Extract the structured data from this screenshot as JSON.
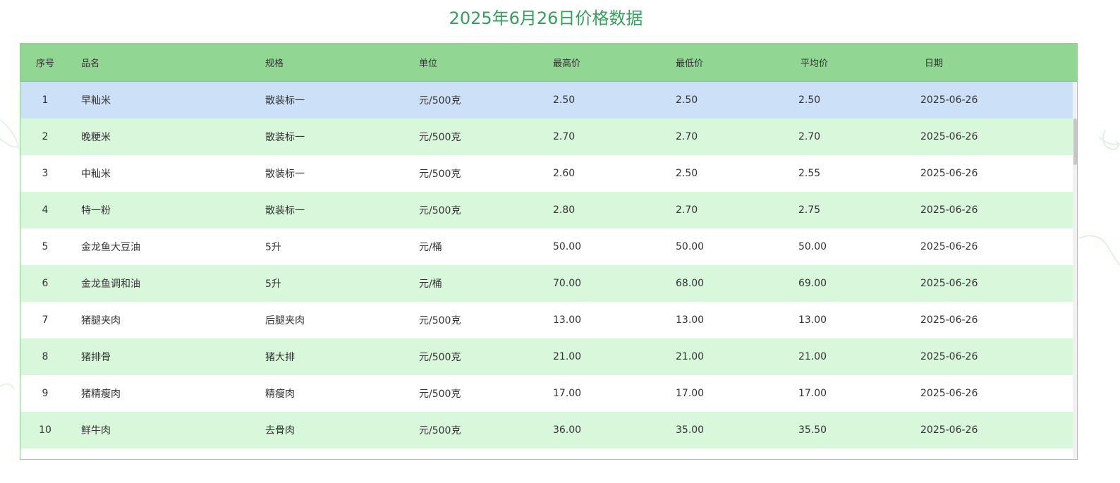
{
  "page": {
    "title": "2025年6月26日价格数据"
  },
  "table": {
    "headers": [
      "序号",
      "品名",
      "规格",
      "单位",
      "最高价",
      "最低价",
      "平均价",
      "日期"
    ],
    "rows": [
      [
        "1",
        "早籼米",
        "散装标一",
        "元/500克",
        "2.50",
        "2.50",
        "2.50",
        "2025-06-26"
      ],
      [
        "2",
        "晚粳米",
        "散装标一",
        "元/500克",
        "2.70",
        "2.70",
        "2.70",
        "2025-06-26"
      ],
      [
        "3",
        "中籼米",
        "散装标一",
        "元/500克",
        "2.60",
        "2.50",
        "2.55",
        "2025-06-26"
      ],
      [
        "4",
        "特一粉",
        "散装标一",
        "元/500克",
        "2.80",
        "2.70",
        "2.75",
        "2025-06-26"
      ],
      [
        "5",
        "金龙鱼大豆油",
        "5升",
        "元/桶",
        "50.00",
        "50.00",
        "50.00",
        "2025-06-26"
      ],
      [
        "6",
        "金龙鱼调和油",
        "5升",
        "元/桶",
        "70.00",
        "68.00",
        "69.00",
        "2025-06-26"
      ],
      [
        "7",
        "猪腿夹肉",
        "后腿夹肉",
        "元/500克",
        "13.00",
        "13.00",
        "13.00",
        "2025-06-26"
      ],
      [
        "8",
        "猪排骨",
        "猪大排",
        "元/500克",
        "21.00",
        "21.00",
        "21.00",
        "2025-06-26"
      ],
      [
        "9",
        "猪精瘦肉",
        "精瘦肉",
        "元/500克",
        "17.00",
        "17.00",
        "17.00",
        "2025-06-26"
      ],
      [
        "10",
        "鲜牛肉",
        "去骨肉",
        "元/500克",
        "36.00",
        "35.00",
        "35.50",
        "2025-06-26"
      ]
    ],
    "selected_row": 0
  },
  "colors": {
    "title": "#2fa35a",
    "header_bg": "#92d694",
    "stripe_bg": "#d9f8db",
    "selected_bg": "#cce0f8",
    "border": "#8fd18f"
  }
}
